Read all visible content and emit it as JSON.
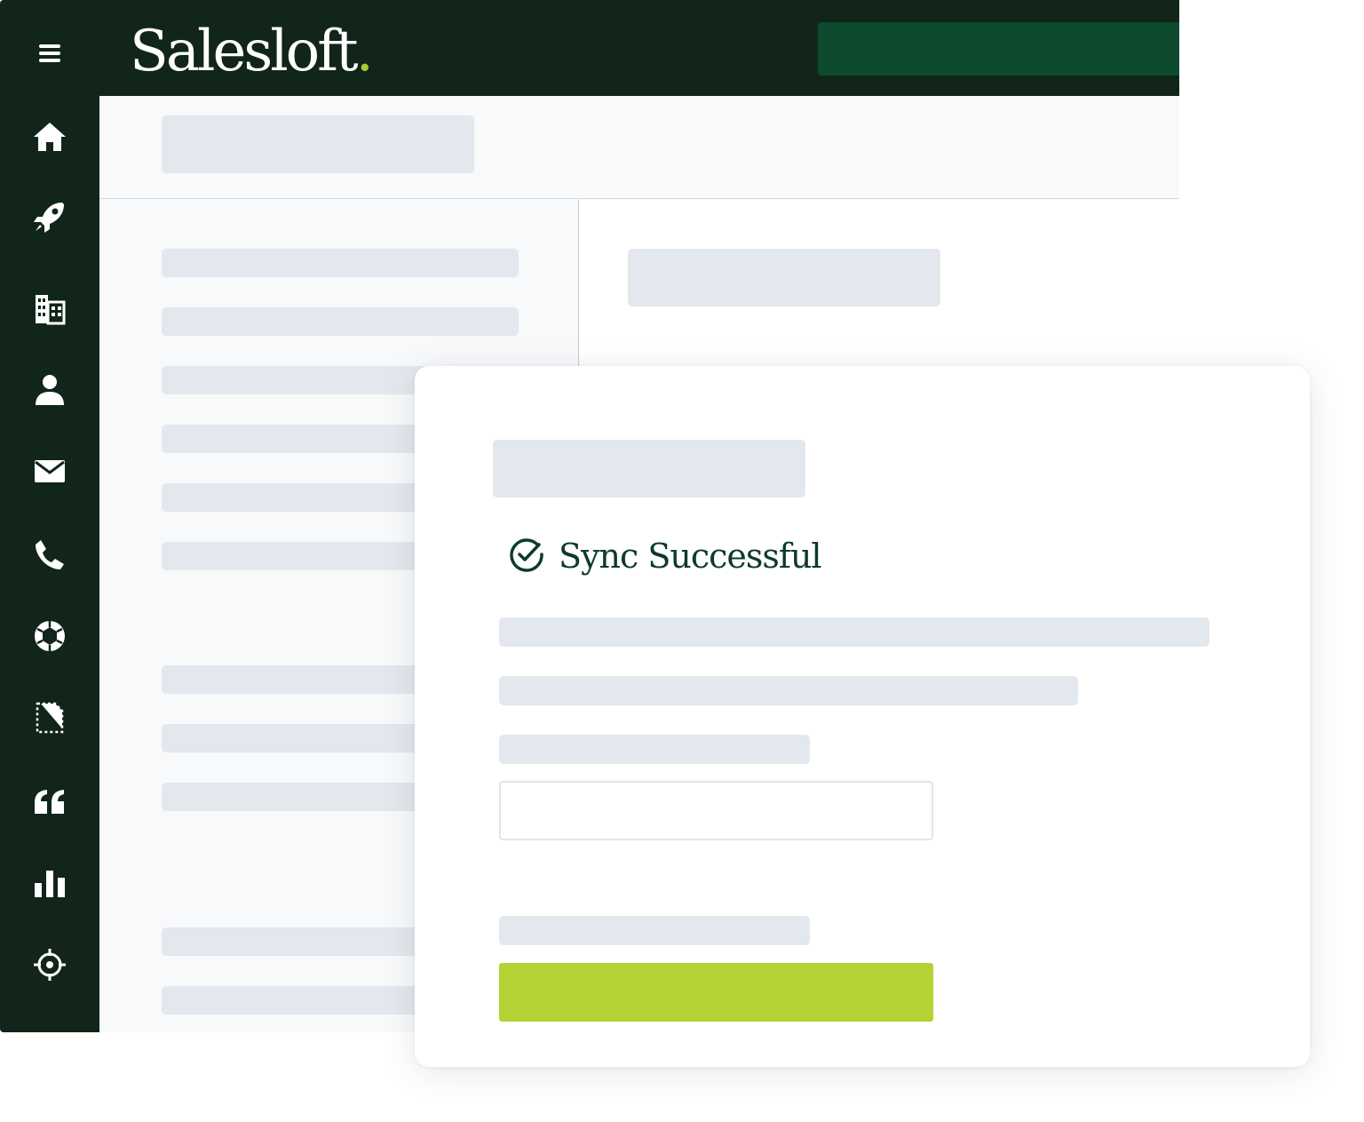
{
  "brand": {
    "name": "Salesloft",
    "dot": ".",
    "colors": {
      "sidebar": "#11251a",
      "accent_dot": "#a8cc2b",
      "cta_dark": "#0d4a2e",
      "primary_button": "#b3d335",
      "success_text": "#0d3b27",
      "skeleton": "#e3e8ee"
    }
  },
  "sidebar": {
    "items": [
      {
        "icon": "menu-icon"
      },
      {
        "icon": "home-icon"
      },
      {
        "icon": "rocket-icon"
      },
      {
        "icon": "building-icon"
      },
      {
        "icon": "person-icon"
      },
      {
        "icon": "mail-icon"
      },
      {
        "icon": "phone-icon"
      },
      {
        "icon": "aperture-icon"
      },
      {
        "icon": "document-icon"
      },
      {
        "icon": "quote-icon"
      },
      {
        "icon": "bar-chart-icon"
      },
      {
        "icon": "crosshair-icon"
      }
    ]
  },
  "modal": {
    "status_icon": "check-circle-icon",
    "status_text": "Sync Successful"
  }
}
